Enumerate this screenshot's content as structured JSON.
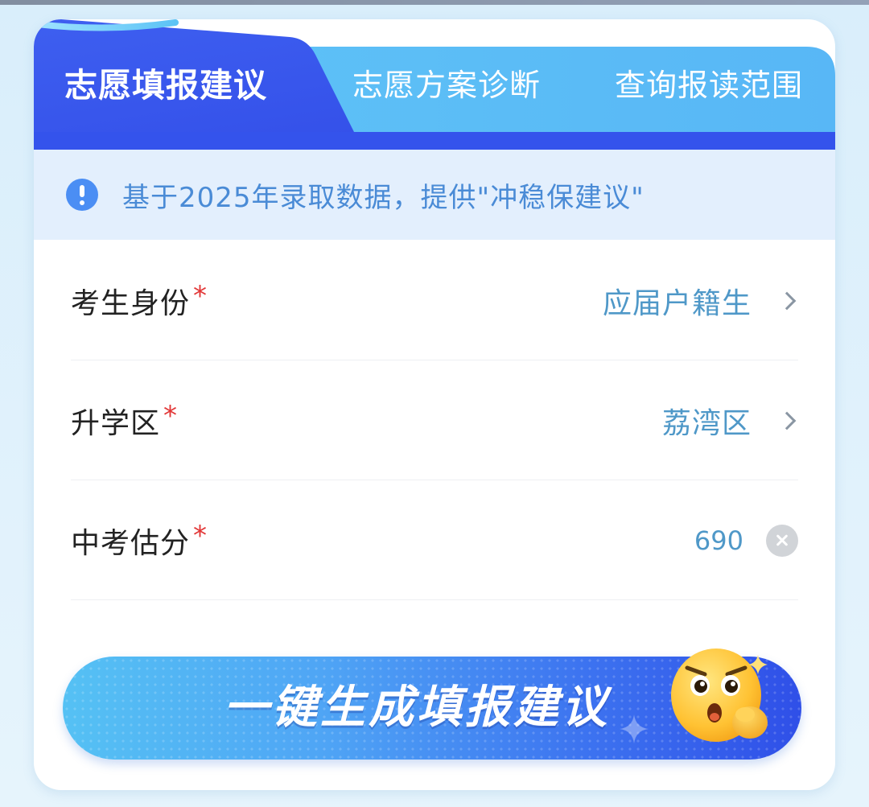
{
  "tabs": [
    {
      "label": "志愿填报建议",
      "active": true
    },
    {
      "label": "志愿方案诊断",
      "active": false
    },
    {
      "label": "查询报读范围",
      "active": false
    }
  ],
  "notice": {
    "icon": "exclamation-circle-icon",
    "text": "基于2025年录取数据，提供\"冲稳保建议\""
  },
  "form": {
    "identity": {
      "label": "考生身份",
      "required_mark": "*",
      "value": "应届户籍生",
      "icon": "chevron-right-icon"
    },
    "district": {
      "label": "升学区",
      "required_mark": "*",
      "value": "荔湾区",
      "icon": "chevron-right-icon"
    },
    "score": {
      "label": "中考估分",
      "required_mark": "*",
      "value": "690",
      "icon": "clear-icon"
    }
  },
  "generate_button": {
    "label": "一键生成填报建议",
    "icon": "surprised-emoji-icon"
  },
  "colors": {
    "tab_active_bg": "#3656ee",
    "tab_inactive_bg": "#5cbcf6",
    "notice_text": "#4a8bd6",
    "value_text": "#4f98c8",
    "required": "#e23838"
  }
}
